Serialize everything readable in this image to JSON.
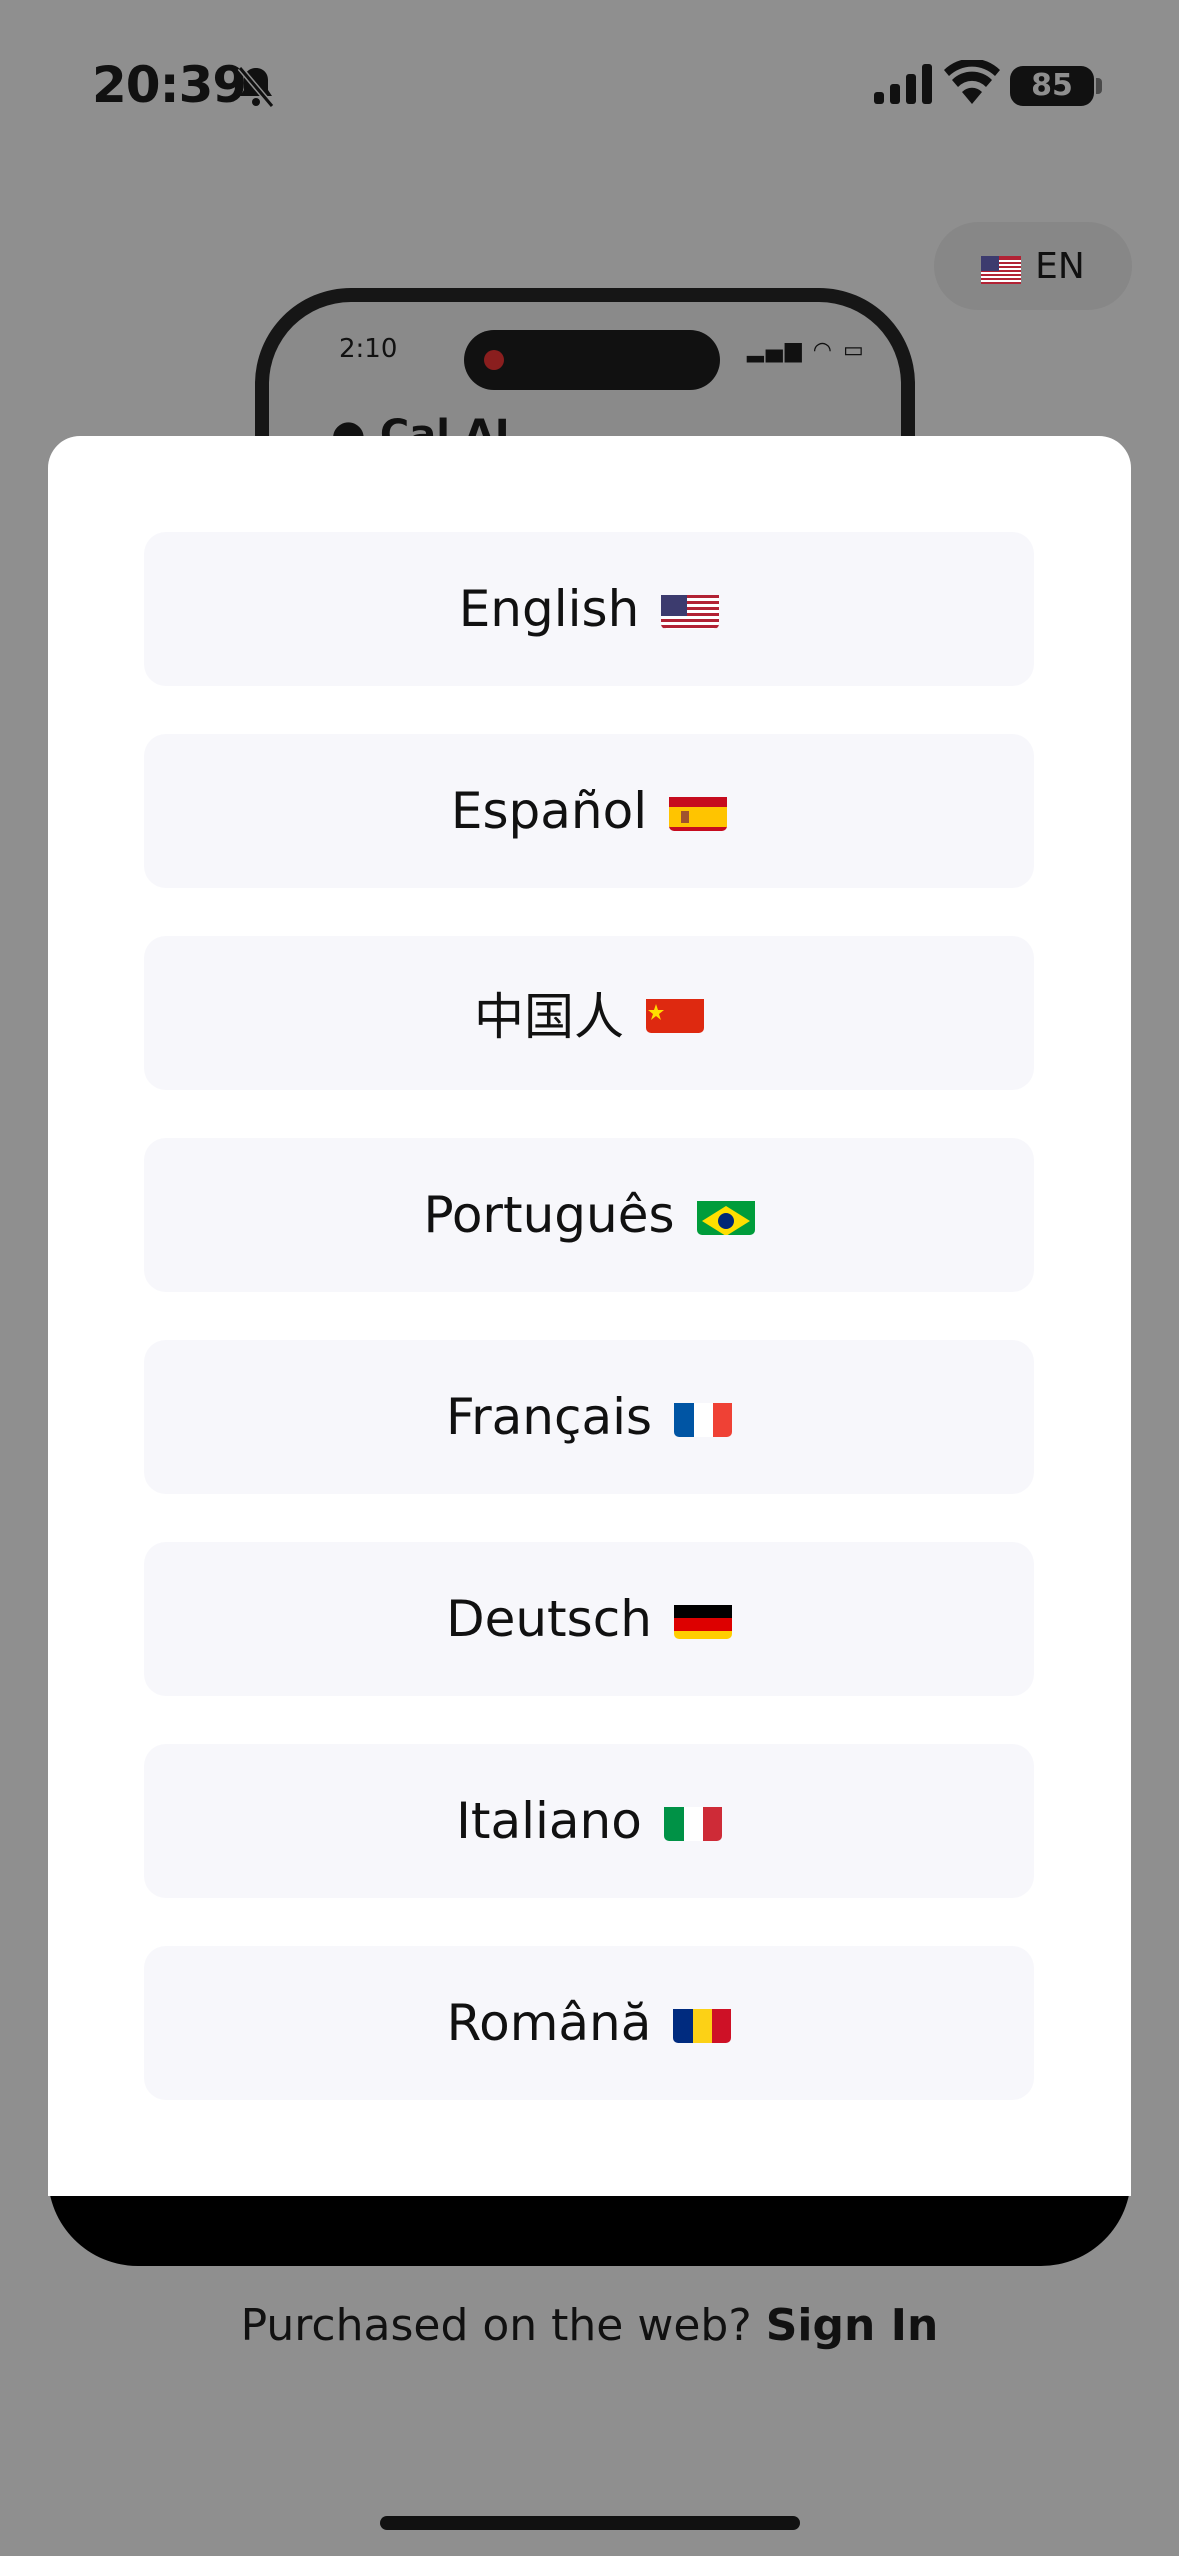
{
  "status_bar": {
    "time": "20:39",
    "battery": "85"
  },
  "language_chip": {
    "label": "EN"
  },
  "preview": {
    "time": "2:10",
    "app_name": "Cal AI"
  },
  "languages": [
    {
      "label": "English",
      "flag": "us"
    },
    {
      "label": "Español",
      "flag": "es"
    },
    {
      "label": "中国人",
      "flag": "cn"
    },
    {
      "label": "Português",
      "flag": "br"
    },
    {
      "label": "Français",
      "flag": "fr"
    },
    {
      "label": "Deutsch",
      "flag": "de"
    },
    {
      "label": "Italiano",
      "flag": "it"
    },
    {
      "label": "Română",
      "flag": "ro"
    }
  ],
  "footer": {
    "prompt": "Purchased on the web?",
    "link": "Sign In"
  },
  "colors": {
    "backdrop": "#8f8f8f",
    "sheet": "#ffffff",
    "option_bg": "#f7f7fb",
    "text": "#111111"
  }
}
